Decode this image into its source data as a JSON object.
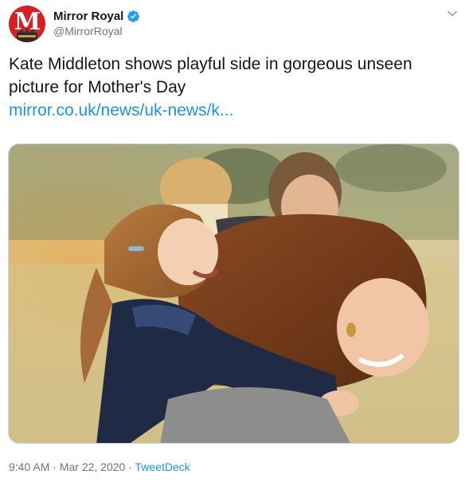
{
  "author": {
    "display_name": "Mirror Royal",
    "handle": "@MirrorRoyal",
    "avatar_letter": "M",
    "verified": true
  },
  "tweet": {
    "text": "Kate Middleton shows playful side in gorgeous unseen picture for Mother's Day",
    "link": "mirror.co.uk/news/uk-news/k..."
  },
  "meta": {
    "time": "9:40 AM",
    "separator_1": "·",
    "date": "Mar 22, 2020",
    "separator_2": "·",
    "source": "TweetDeck"
  },
  "colors": {
    "link": "#1b95e0",
    "secondary_text": "#657786",
    "verified": "#1da1f2",
    "avatar_bg": "#d81f26"
  },
  "icons": {
    "verified": "verified-badge-icon",
    "caret": "chevron-down-icon"
  }
}
